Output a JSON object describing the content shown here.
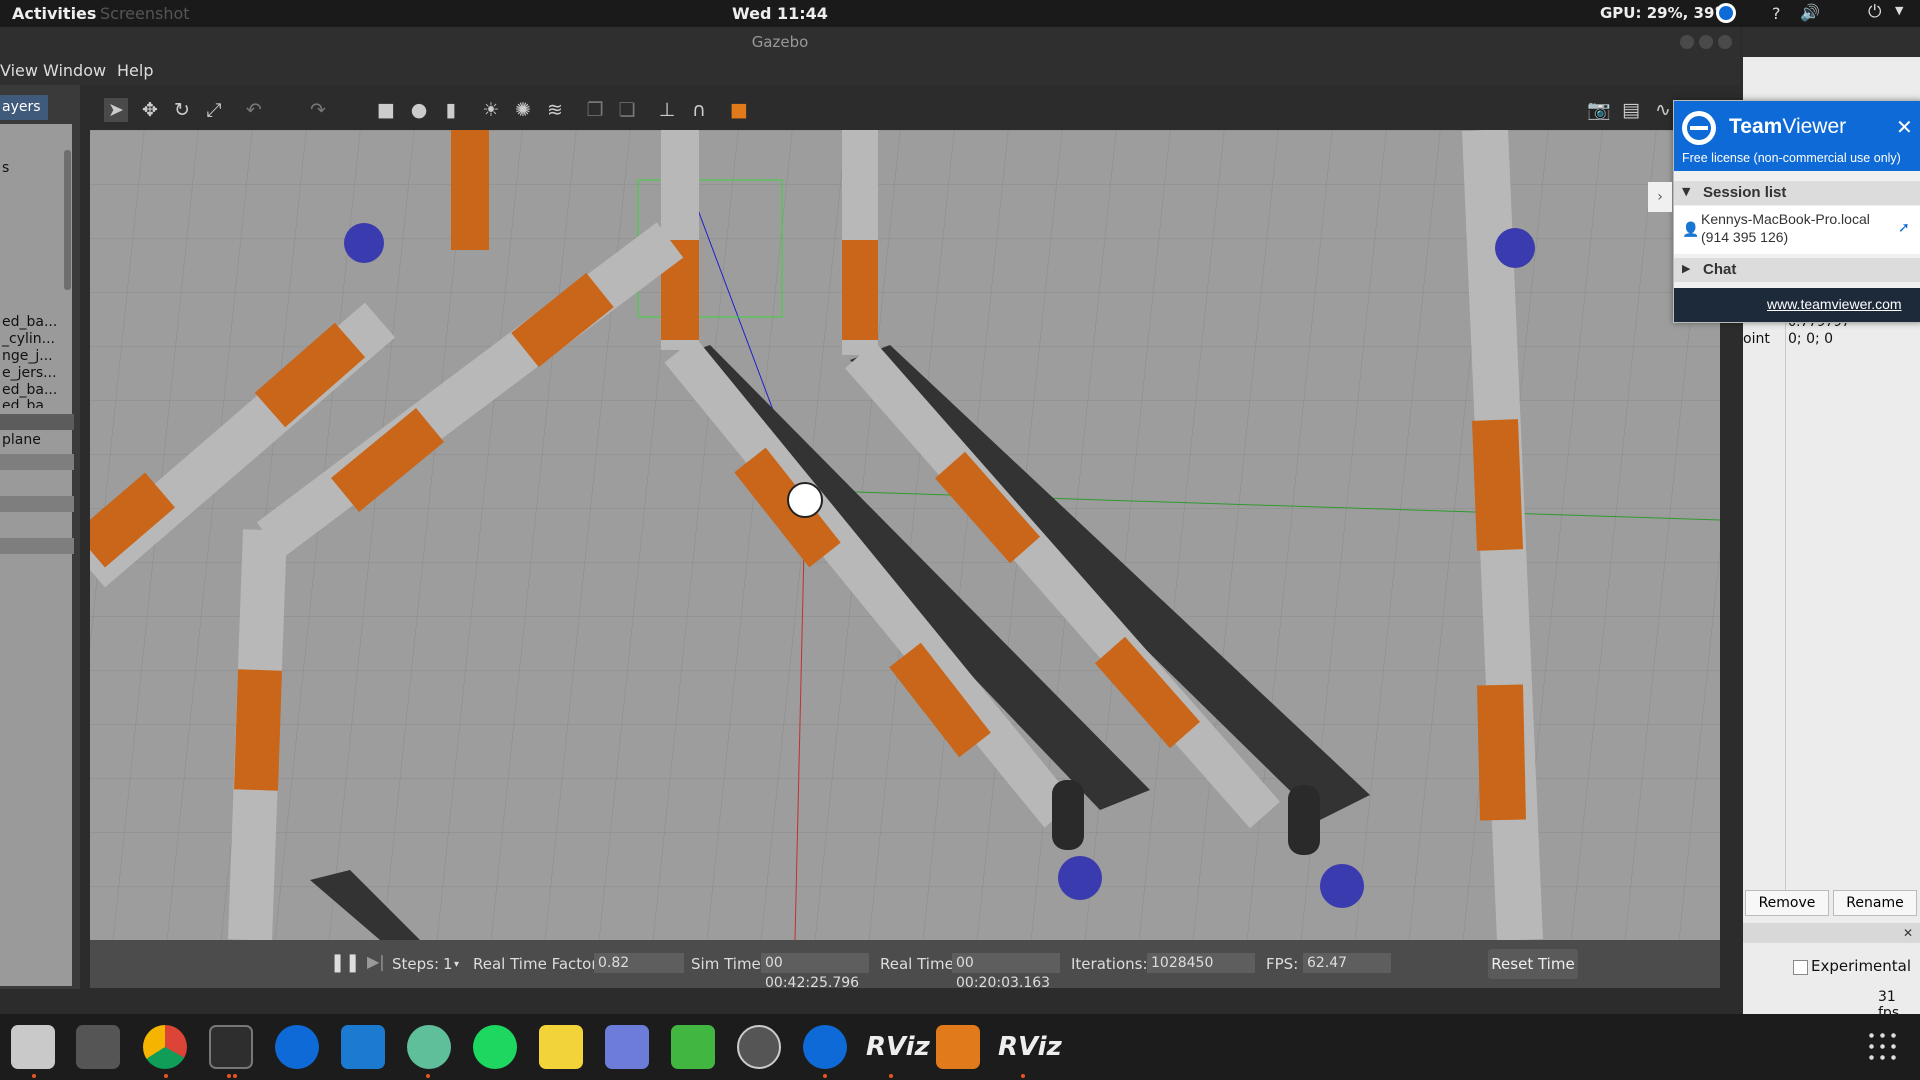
{
  "topbar": {
    "activities": "Activities",
    "screenshot": "Screenshot",
    "clock": "Wed 11:44",
    "gpu": "GPU: 29%, 39°C"
  },
  "window": {
    "title": "Gazebo"
  },
  "menu": {
    "view": "View",
    "window": "Window",
    "help": "Help"
  },
  "left_panel": {
    "tab": "ayers",
    "s": "s",
    "items": [
      "ed_ba...",
      "_cylin...",
      "nge_j...",
      "e_jers...",
      "ed_ba...",
      "ed_ba..."
    ],
    "plane": "plane"
  },
  "bottom_bar": {
    "steps_label": "Steps:",
    "steps_value": "1",
    "rtf_label": "Real Time Factor:",
    "rtf_value": "0.82",
    "sim_label": "Sim Time:",
    "sim_value": "00 00:42:25.796",
    "real_label": "Real Time:",
    "real_value": "00 00:20:03.163",
    "iter_label": "Iterations:",
    "iter_value": "1028450",
    "fps_label": "FPS:",
    "fps_value": "62.47",
    "reset": "Reset Time"
  },
  "teamviewer": {
    "title_bold": "Team",
    "title_rest": "Viewer",
    "license": "Free license (non-commercial use only)",
    "session_list": "Session list",
    "session_name": "Kennys-MacBook-Pro.local",
    "session_id": "(914 395 126)",
    "chat": "Chat",
    "link": "www.teamviewer.com"
  },
  "right_panel": {
    "value1": "0.779797",
    "label2": "oint",
    "value2": "0; 0; 0",
    "remove": "Remove",
    "rename": "Rename",
    "experimental": "Experimental",
    "fps": "31 fps"
  },
  "dock": {
    "apps": [
      "files",
      "settings",
      "chrome",
      "terminal",
      "teamviewer",
      "virtualbox",
      "atom",
      "spotify",
      "notes",
      "discord",
      "qt",
      "updater",
      "teamviewer",
      "RViz",
      "sublime",
      "RViz"
    ]
  }
}
